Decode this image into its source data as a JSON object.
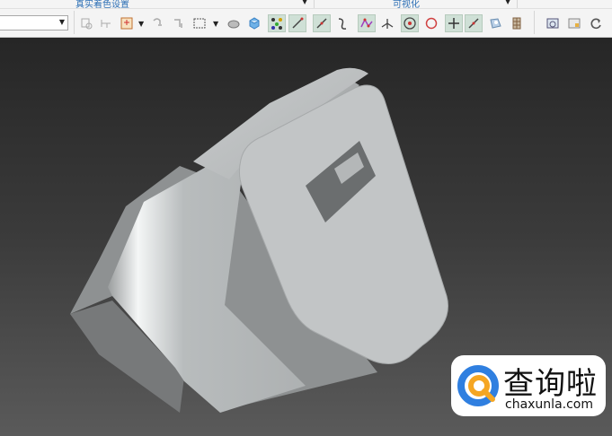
{
  "ribbon": {
    "groups": [
      {
        "label": "真实着色设置"
      },
      {
        "label": "可视化"
      }
    ],
    "combo_value": "",
    "tools": [
      "display-style-icon",
      "tangent-icon",
      "datum-display-icon",
      "spin-center-icon",
      "named-view-icon",
      "selection-box-icon",
      "appearance-icon",
      "render-icon",
      "datum-points-icon",
      "axis-icon",
      "plane-line-icon",
      "curve-icon",
      "spline-icon",
      "csys-icon",
      "point-target-icon",
      "circle-icon",
      "plus-icon",
      "line-icon",
      "sphere-icon",
      "grid-icon",
      "view-manager-icon",
      "window-icon",
      "refresh-icon"
    ]
  },
  "watermark": {
    "cn": "查询啦",
    "en": "chaxunla.com",
    "colors": {
      "blue": "#2f7fe0",
      "orange": "#f5a623"
    }
  }
}
